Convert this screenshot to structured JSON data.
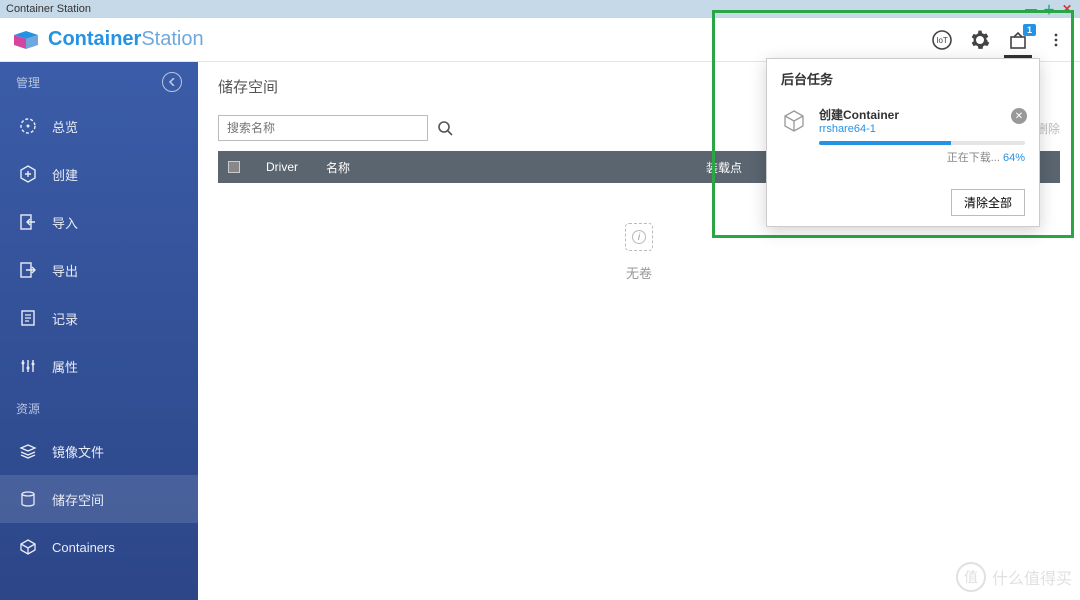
{
  "titlebar": {
    "title": "Container Station"
  },
  "header": {
    "logo_part1": "Container",
    "logo_part2": "Station",
    "badge_count": "1"
  },
  "sidebar": {
    "section1": "管理",
    "section2": "资源",
    "items": {
      "overview": "总览",
      "create": "创建",
      "import": "导入",
      "export": "导出",
      "logs": "记录",
      "properties": "属性",
      "images": "镜像文件",
      "volumes": "储存空间",
      "containers": "Containers"
    }
  },
  "main": {
    "title": "储存空间",
    "search_placeholder": "搜索名称",
    "cols": {
      "driver": "Driver",
      "name": "名称",
      "mount": "装载点"
    },
    "empty": "无卷"
  },
  "popover": {
    "header": "后台任务",
    "task_title": "创建Container",
    "task_sub": "rrshare64-1",
    "status_text": "正在下载...",
    "percent": "64%",
    "clear": "清除全部"
  },
  "hidden": {
    "del": "删除"
  },
  "watermark": {
    "symbol": "值",
    "text": "什么值得买"
  }
}
